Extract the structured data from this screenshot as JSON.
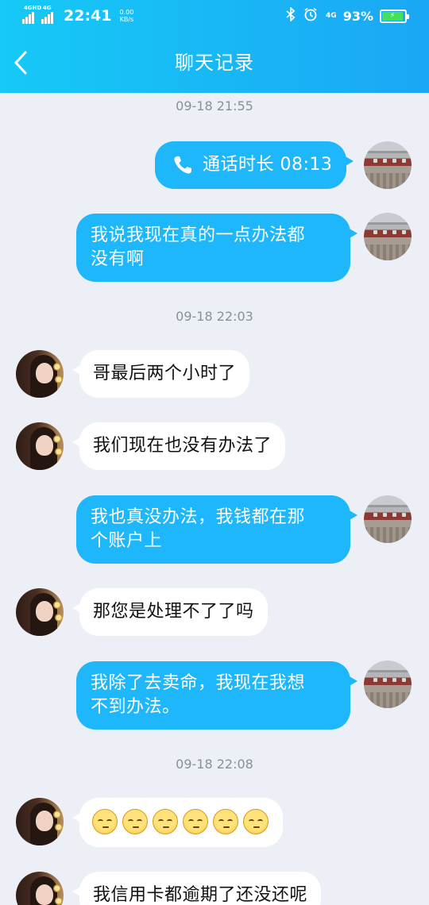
{
  "status_bar": {
    "network_1": "4GHD",
    "network_2": "4G",
    "time": "22:41",
    "speed_value": "0.00",
    "speed_unit": "KB/s",
    "bluetooth_icon": "bluetooth-icon",
    "alarm_icon": "alarm-icon",
    "network_3": "4G",
    "battery_percent": "93%",
    "battery_level": 0.93
  },
  "header": {
    "title": "聊天记录",
    "back_icon": "chevron-left-icon"
  },
  "colors": {
    "header_start": "#16c9f6",
    "header_end": "#1aa7f5",
    "self_bubble": "#1fb7fb",
    "other_bubble": "#ffffff",
    "background": "#eceff5"
  },
  "timestamps": [
    "09-18 21:55",
    "09-18 22:03",
    "09-18 22:08"
  ],
  "messages": [
    {
      "side": "self",
      "type": "call",
      "icon": "phone-icon",
      "text": "通话时长 08:13"
    },
    {
      "side": "self",
      "type": "text",
      "lines": [
        "我说我现在真的一点办法都",
        "没有啊"
      ]
    },
    {
      "side": "other",
      "type": "text",
      "lines": [
        "哥最后两个小时了"
      ]
    },
    {
      "side": "other",
      "type": "text",
      "lines": [
        "我们现在也没有办法了"
      ]
    },
    {
      "side": "self",
      "type": "text",
      "lines": [
        "我也真没办法，我钱都在那",
        "个账户上"
      ]
    },
    {
      "side": "other",
      "type": "text",
      "lines": [
        "那您是处理不了了吗"
      ]
    },
    {
      "side": "self",
      "type": "text",
      "lines": [
        "我除了去卖命，我现在我想",
        "不到办法。"
      ]
    },
    {
      "side": "other",
      "type": "emoji",
      "emoji": "unamused-face-icon",
      "count": 6
    },
    {
      "side": "other",
      "type": "text",
      "lines": [
        "我信用卡都逾期了还没还呢"
      ]
    }
  ]
}
